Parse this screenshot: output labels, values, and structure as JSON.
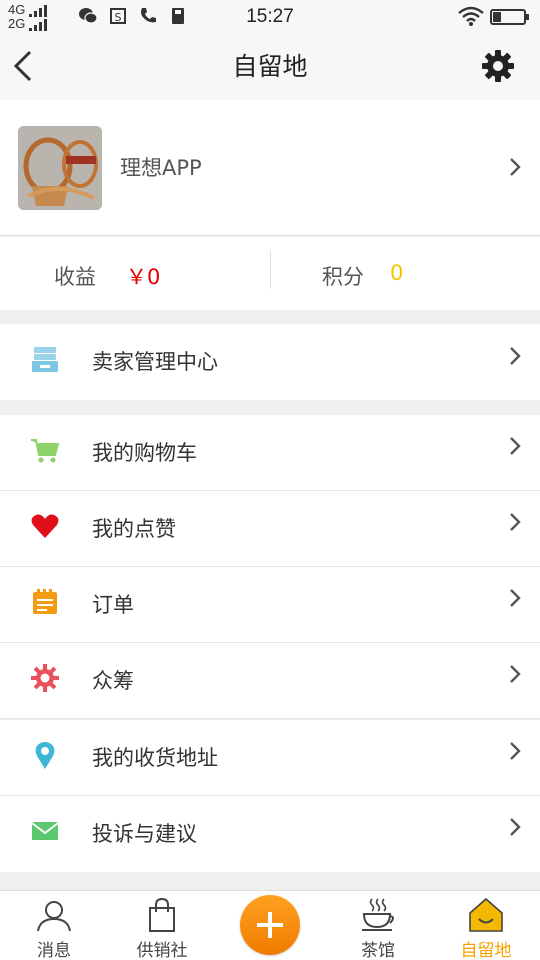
{
  "status_bar": {
    "network_top": "4G",
    "network_bottom": "2G",
    "time": "15:27"
  },
  "nav": {
    "title": "自留地",
    "back_icon": "chevron-left-icon",
    "settings_icon": "gear-icon"
  },
  "profile": {
    "name": "理想APP"
  },
  "stats": {
    "income_label": "收益",
    "income_value": "￥0",
    "points_label": "积分",
    "points_value": "0",
    "income_color": "#e60000",
    "points_color": "#f5c400"
  },
  "seller": {
    "label": "卖家管理中心",
    "icon": "drawer-icon"
  },
  "menu": {
    "items": [
      {
        "label": "我的购物车",
        "icon": "cart-icon"
      },
      {
        "label": "我的点赞",
        "icon": "heart-icon"
      },
      {
        "label": "订单",
        "icon": "notepad-icon"
      },
      {
        "label": "众筹",
        "icon": "gear-icon"
      },
      {
        "label": "我的收货地址",
        "icon": "location-pin-icon"
      },
      {
        "label": "投诉与建议",
        "icon": "envelope-icon"
      }
    ]
  },
  "tabs": [
    {
      "label": "消息",
      "icon": "user-icon"
    },
    {
      "label": "供销社",
      "icon": "shopping-bag-icon"
    },
    {
      "label": "茶馆",
      "icon": "tea-cup-icon"
    },
    {
      "label": "自留地",
      "icon": "house-icon",
      "active": true
    }
  ],
  "colors": {
    "accent": "#f5a200",
    "active_tab": "#f5a200"
  }
}
